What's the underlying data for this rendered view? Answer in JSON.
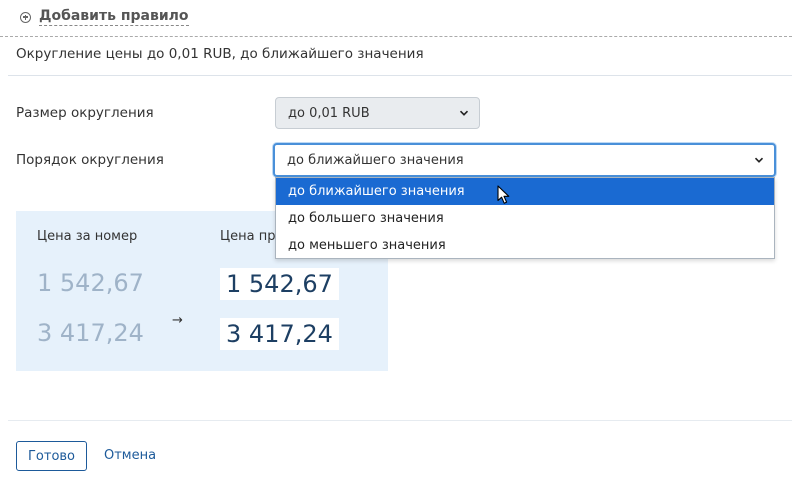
{
  "add_rule": {
    "label": "Добавить правило",
    "icon": "plus-circle-icon"
  },
  "summary": "Округление цены до 0,01 RUB, до ближайшего значения",
  "form": {
    "size_label": "Размер округления",
    "size_value": "до 0,01 RUB",
    "order_label": "Порядок округления",
    "order_value": "до ближайшего значения",
    "order_options": [
      "до ближайшего значения",
      "до большего значения",
      "до меньшего значения"
    ],
    "highlighted_option_index": 0
  },
  "preview": {
    "col_before_header": "Цена за номер",
    "col_after_header": "Цена пр",
    "rows": [
      {
        "before": "1 542,67",
        "after": "1 542,67"
      },
      {
        "before": "3 417,24",
        "after": "3 417,24"
      }
    ],
    "arrow": "→"
  },
  "footer": {
    "done_label": "Готово",
    "cancel_label": "Отмена"
  },
  "colors": {
    "accent": "#1d5a9a",
    "highlight": "#1a6ad2",
    "preview_bg": "#e6f1fb"
  }
}
